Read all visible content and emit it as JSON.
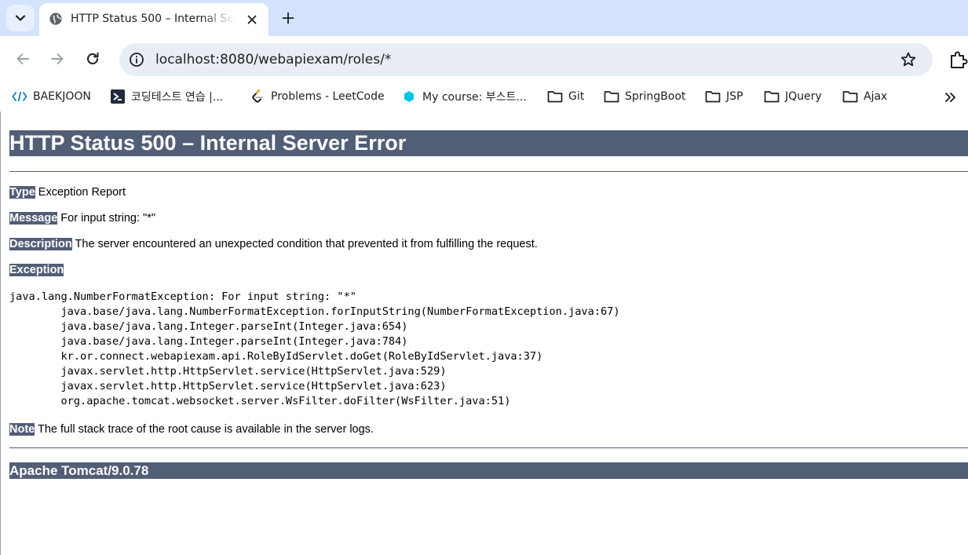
{
  "tab": {
    "title": "HTTP Status 500 – Internal Server Error"
  },
  "omnibox": {
    "url": "localhost:8080/webapiexam/roles/*"
  },
  "bookmarks": [
    {
      "label": "BAEKJOON",
      "icon": "code-bracket-icon"
    },
    {
      "label": "코딩테스트 연습 |...",
      "icon": "programmers-icon"
    },
    {
      "label": "Problems - LeetCode",
      "icon": "leetcode-icon"
    },
    {
      "label": "My course: 부스트...",
      "icon": "boostcourse-icon"
    },
    {
      "label": "Git",
      "icon": "folder-icon"
    },
    {
      "label": "SpringBoot",
      "icon": "folder-icon"
    },
    {
      "label": "JSP",
      "icon": "folder-icon"
    },
    {
      "label": "JQuery",
      "icon": "folder-icon"
    },
    {
      "label": "Ajax",
      "icon": "folder-icon"
    }
  ],
  "error": {
    "heading": "HTTP Status 500 – Internal Server Error",
    "type_label": "Type",
    "type_value": " Exception Report",
    "message_label": "Message",
    "message_value": " For input string: \"*\"",
    "description_label": "Description",
    "description_value": " The server encountered an unexpected condition that prevented it from fulfilling the request.",
    "exception_label": "Exception",
    "stack_trace": "java.lang.NumberFormatException: For input string: \"*\"\n\tjava.base/java.lang.NumberFormatException.forInputString(NumberFormatException.java:67)\n\tjava.base/java.lang.Integer.parseInt(Integer.java:654)\n\tjava.base/java.lang.Integer.parseInt(Integer.java:784)\n\tkr.or.connect.webapiexam.api.RoleByIdServlet.doGet(RoleByIdServlet.java:37)\n\tjavax.servlet.http.HttpServlet.service(HttpServlet.java:529)\n\tjavax.servlet.http.HttpServlet.service(HttpServlet.java:623)\n\torg.apache.tomcat.websocket.server.WsFilter.doFilter(WsFilter.java:51)",
    "note_label": "Note",
    "note_value": " The full stack trace of the root cause is available in the server logs.",
    "server_footer": "Apache Tomcat/9.0.78"
  },
  "colors": {
    "tomcat_header_bg": "#525d76",
    "tab_strip_bg": "#d3e3fd",
    "omnibox_bg": "#e9eef6"
  }
}
